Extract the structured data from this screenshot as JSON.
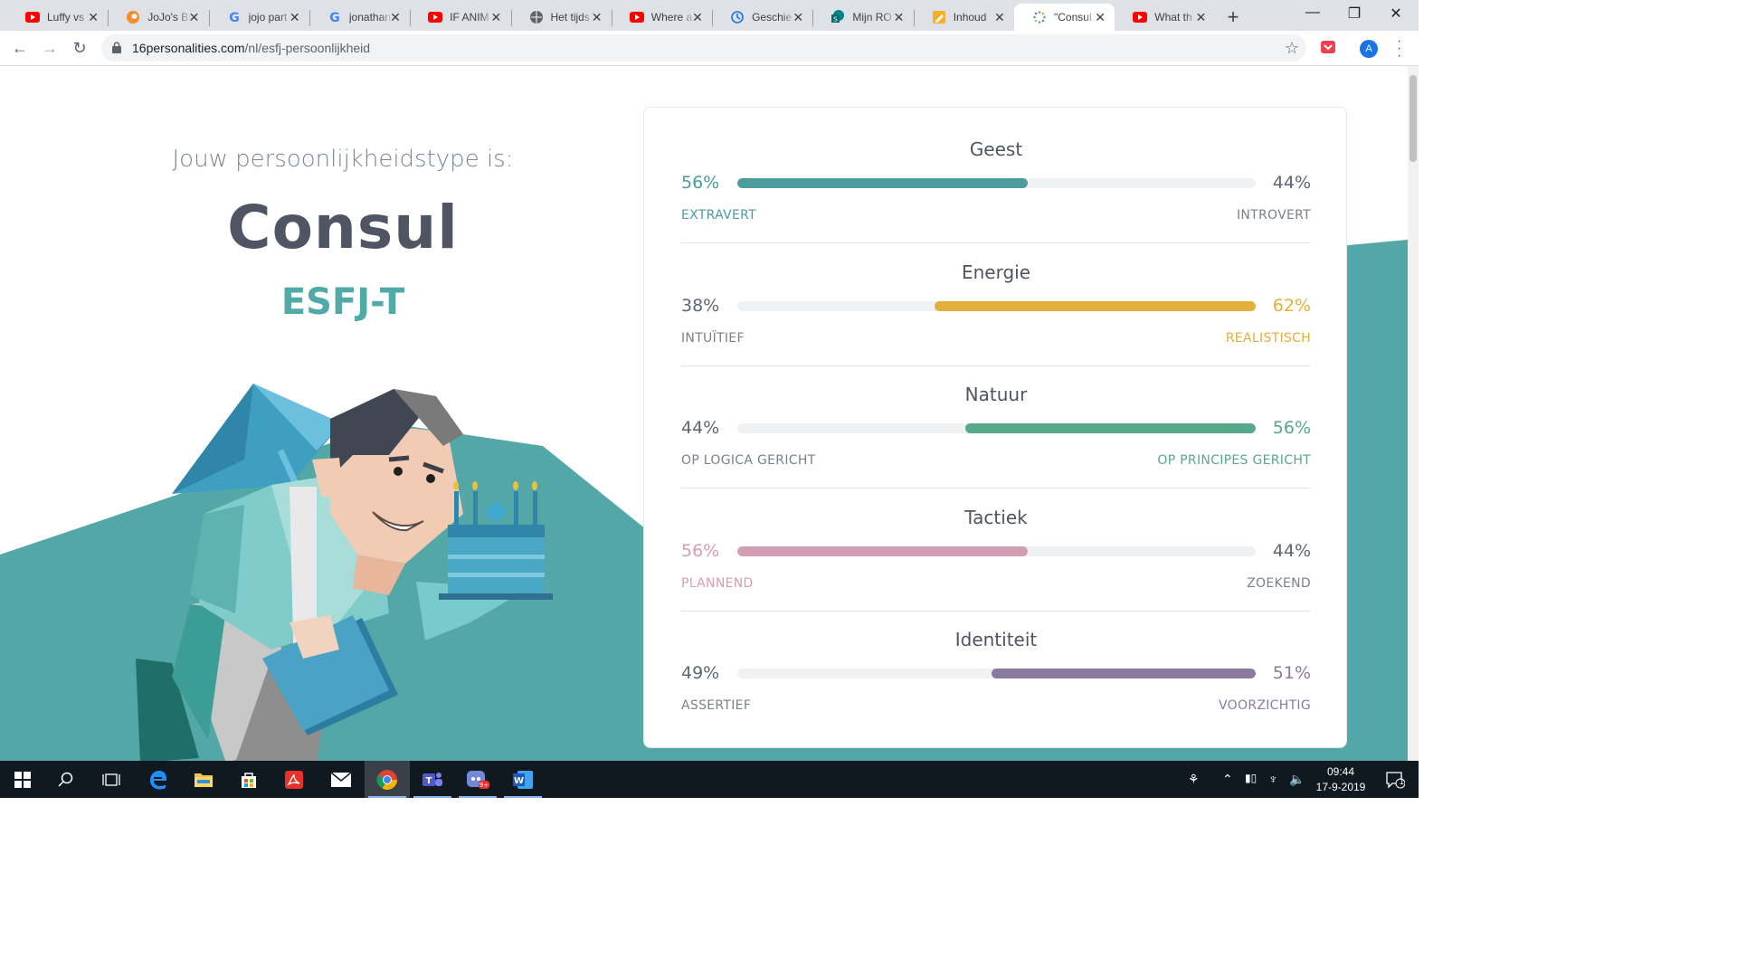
{
  "browser": {
    "tabs": [
      {
        "title": "Luffy vs",
        "icon": "youtube-icon"
      },
      {
        "title": "JoJo's Bi",
        "icon": "crunchyroll-icon"
      },
      {
        "title": "jojo part",
        "icon": "google-icon"
      },
      {
        "title": "jonathan",
        "icon": "google-icon"
      },
      {
        "title": "IF ANIM",
        "icon": "youtube-icon"
      },
      {
        "title": "Het tijds",
        "icon": "globe-icon"
      },
      {
        "title": "Where a",
        "icon": "youtube-icon"
      },
      {
        "title": "Geschie",
        "icon": "history-icon"
      },
      {
        "title": "Mijn RO",
        "icon": "sharepoint-icon"
      },
      {
        "title": "Inhoud",
        "icon": "pencil-icon"
      },
      {
        "title": "\"Consul",
        "icon": "loading-icon",
        "active": true
      },
      {
        "title": "What th",
        "icon": "youtube-icon"
      }
    ],
    "url_domain": "16personalities.com",
    "url_path": "/nl/esfj-persoonlijkheid",
    "avatar_letter": "A"
  },
  "hero": {
    "intro": "Jouw persoonlijkheidstype is:",
    "name": "Consul",
    "code": "ESFJ-T"
  },
  "traits": [
    {
      "name": "Geest",
      "left_pct": "56%",
      "right_pct": "44%",
      "left_label": "EXTRAVERT",
      "right_label": "INTROVERT",
      "value": 0.56,
      "side": "left",
      "color": "#4a9d9c"
    },
    {
      "name": "Energie",
      "left_pct": "38%",
      "right_pct": "62%",
      "left_label": "INTUÏTIEF",
      "right_label": "REALISTISCH",
      "value": 0.62,
      "side": "right",
      "color": "#e4ae3a"
    },
    {
      "name": "Natuur",
      "left_pct": "44%",
      "right_pct": "56%",
      "left_label": "OP LOGICA GERICHT",
      "right_label": "OP PRINCIPES GERICHT",
      "value": 0.56,
      "side": "right",
      "color": "#56a88a"
    },
    {
      "name": "Tactiek",
      "left_pct": "56%",
      "right_pct": "44%",
      "left_label": "PLANNEND",
      "right_label": "ZOEKEND",
      "value": 0.56,
      "side": "left",
      "color": "#d39db4"
    },
    {
      "name": "Identiteit",
      "left_pct": "49%",
      "right_pct": "51%",
      "left_label": "ASSERTIEF",
      "right_label": "VOORZICHTIG",
      "value": 0.51,
      "side": "right",
      "color": "#8b7aa0"
    }
  ],
  "colors": {
    "neutral_text": "#5f6672",
    "accent_teal": "#4faaa8"
  },
  "taskbar": {
    "time": "09:44",
    "date": "17-9-2019",
    "notification_count": "1"
  }
}
